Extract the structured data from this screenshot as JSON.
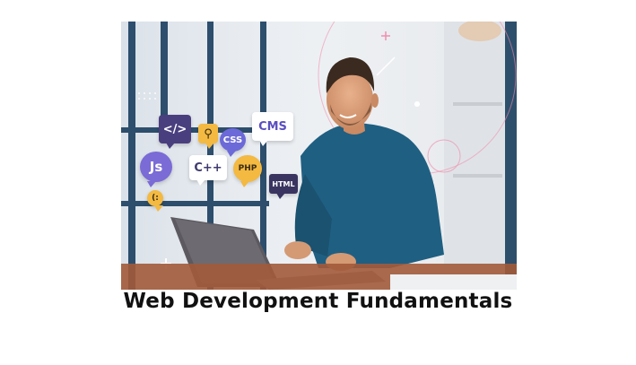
{
  "hero": {
    "badges": {
      "code": "</>",
      "css": "CSS",
      "cms": "CMS",
      "js": "Js",
      "cpp": "C++",
      "php": "PHP",
      "html": "HTML",
      "emoji": "(:"
    },
    "colors": {
      "primary_badge": "#4a3f7e",
      "accent_badge": "#f3b941",
      "violet_badge": "#7a6bd6",
      "sweater": "#1f5f82"
    }
  },
  "caption": "Web Development Fundamentals"
}
